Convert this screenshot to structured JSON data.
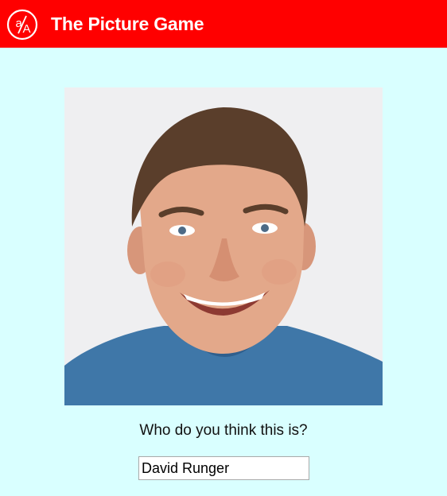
{
  "header": {
    "title": "The Picture Game",
    "logo_text": "a/A",
    "background_color": "#ff0000"
  },
  "main": {
    "photo": {
      "icon": "person-photo"
    },
    "question": "Who do you think this is?",
    "answer": {
      "value": "David Runger",
      "placeholder": ""
    }
  },
  "colors": {
    "page_background": "#d9ffff",
    "header_text": "#ffffff"
  }
}
